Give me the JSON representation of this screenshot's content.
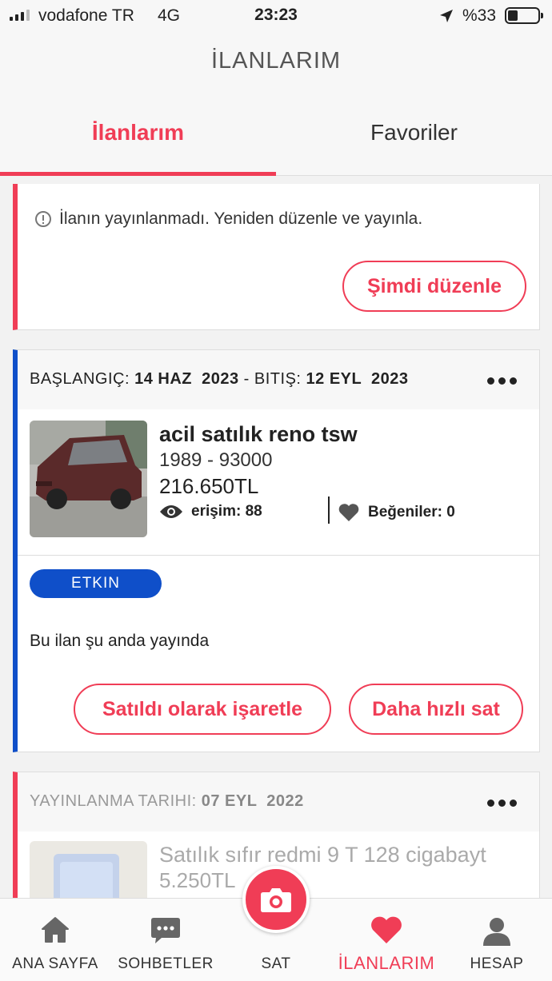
{
  "status_bar": {
    "carrier": "vodafone TR",
    "network": "4G",
    "time": "23:23",
    "battery": "%33",
    "battery_level": 0.33
  },
  "header": {
    "title": "İLANLARIM",
    "tabs": [
      {
        "label": "İlanlarım",
        "active": true
      },
      {
        "label": "Favoriler",
        "active": false
      }
    ]
  },
  "card1": {
    "warning": "İlanın yayınlanmadı. Yeniden düzenle ve yayınla.",
    "edit_button": "Şimdi düzenle"
  },
  "card2": {
    "start_label": "BAŞLANGIÇ:",
    "start_date": "14 HAZ  2023",
    "end_label": " - BITIŞ:",
    "end_date": "12 EYL  2023",
    "title": "acil satılık reno tsw",
    "subtitle": "1989 - 93000",
    "price": "216.650TL",
    "views": "erişim: 88",
    "likes": "Beğeniler: 0",
    "badge": "ETKIN",
    "status_text": "Bu ilan şu anda yayında",
    "mark_sold_button": "Satıldı olarak işaretle",
    "sell_faster_button": "Daha hızlı sat"
  },
  "card3": {
    "date_label": "YAYINLANMA TARIHI:",
    "date": "07 EYL  2022",
    "title": "Satılık sıfır redmi 9 T 128 cigabayt",
    "price": "5.250TL"
  },
  "bottom_nav": [
    {
      "label": "ANA SAYFA",
      "icon": "home-icon"
    },
    {
      "label": "SOHBETLER",
      "icon": "chat-icon"
    },
    {
      "label": "SAT",
      "icon": "camera-icon"
    },
    {
      "label": "İLANLARIM",
      "icon": "heart-icon",
      "active": true
    },
    {
      "label": "HESAP",
      "icon": "person-icon"
    }
  ],
  "colors": {
    "accent": "#f03d56",
    "active_blue": "#0f4fc9"
  }
}
